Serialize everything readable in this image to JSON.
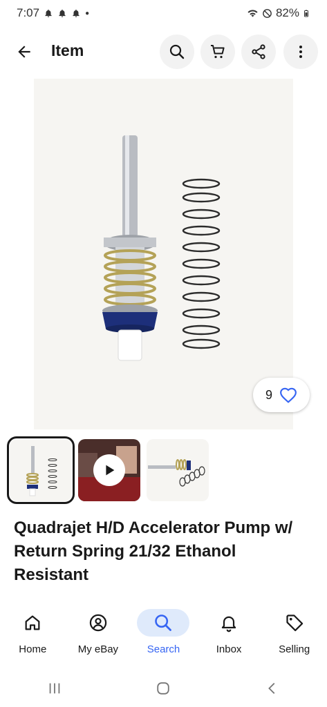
{
  "status_bar": {
    "time": "7:07",
    "battery": "82%",
    "icons": [
      "notification-bell-icon",
      "wifi-icon",
      "do-not-disturb-icon",
      "battery-icon"
    ]
  },
  "app_bar": {
    "title": "Item",
    "actions": [
      "search-icon",
      "cart-icon",
      "share-icon",
      "more-vert-icon"
    ]
  },
  "listing": {
    "favorites_count": "9",
    "title": "Quadrajet H/D Accelerator Pump w/ Return Spring 21/32 Ethanol Resistant",
    "thumbnails": [
      {
        "kind": "photo",
        "selected": true
      },
      {
        "kind": "video",
        "selected": false
      },
      {
        "kind": "photo",
        "selected": false
      }
    ]
  },
  "bottom_nav": {
    "items": [
      {
        "label": "Home",
        "icon": "home-icon",
        "active": false
      },
      {
        "label": "My eBay",
        "icon": "account-icon",
        "active": false
      },
      {
        "label": "Search",
        "icon": "search-icon",
        "active": true
      },
      {
        "label": "Inbox",
        "icon": "bell-icon",
        "active": false
      },
      {
        "label": "Selling",
        "icon": "tag-icon",
        "active": false
      }
    ]
  },
  "colors": {
    "accent": "#3665f3",
    "active_nav_bg": "#dfeafb",
    "button_bg": "#f2f2f2",
    "text": "#191919"
  }
}
